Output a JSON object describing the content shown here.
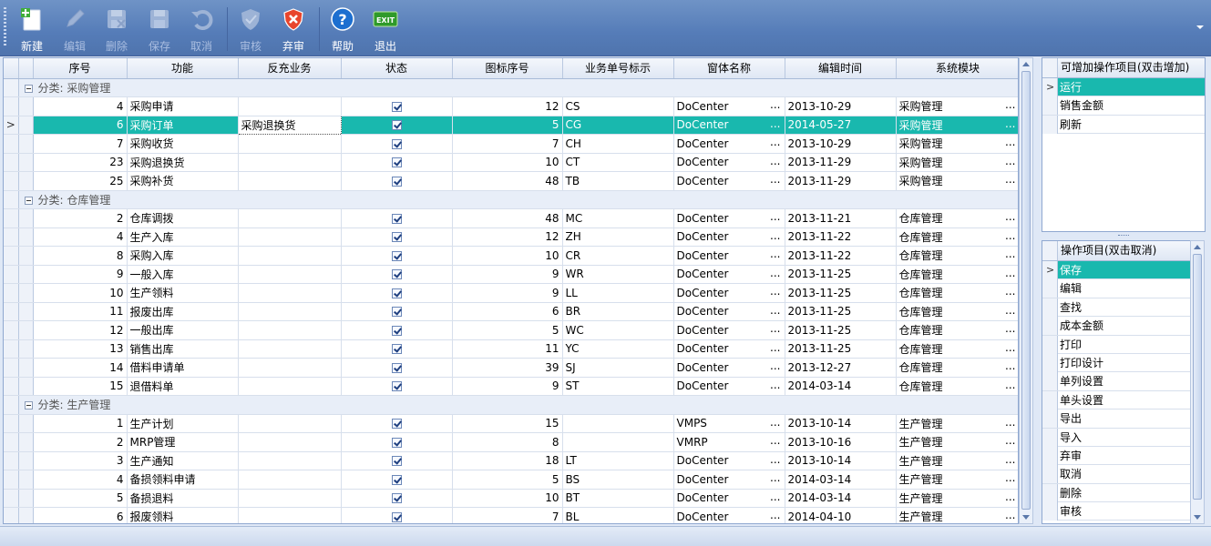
{
  "toolbar": {
    "buttons": [
      {
        "label": "新建",
        "icon": "new-document-icon",
        "enabled": true
      },
      {
        "label": "编辑",
        "icon": "pencil-icon",
        "enabled": false
      },
      {
        "label": "删除",
        "icon": "delete-disk-icon",
        "enabled": false
      },
      {
        "label": "保存",
        "icon": "save-disk-icon",
        "enabled": false
      },
      {
        "label": "取消",
        "icon": "undo-icon",
        "enabled": false
      },
      {
        "label": "审核",
        "icon": "shield-icon",
        "enabled": false
      },
      {
        "label": "弃审",
        "icon": "abandon-x-icon",
        "enabled": true
      },
      {
        "label": "帮助",
        "icon": "help-icon",
        "enabled": true
      },
      {
        "label": "退出",
        "icon": "exit-icon",
        "enabled": true
      }
    ],
    "exit_badge": "EXIT"
  },
  "grid": {
    "columns": [
      "序号",
      "功能",
      "反充业务",
      "状态",
      "图标序号",
      "业务单号标示",
      "窗体名称",
      "编辑时间",
      "系统模块"
    ],
    "groups": [
      {
        "title": "分类: 采购管理",
        "rows": [
          {
            "seq": "4",
            "func": "采购申请",
            "reverse": "",
            "icon_no": "12",
            "code": "CS",
            "form": "DoCenter",
            "time": "2013-10-29",
            "module": "采购管理"
          },
          {
            "seq": "6",
            "func": "采购订单",
            "reverse": "采购退换货",
            "icon_no": "5",
            "code": "CG",
            "form": "DoCenter",
            "time": "2014-05-27",
            "module": "采购管理",
            "selected": true
          },
          {
            "seq": "7",
            "func": "采购收货",
            "reverse": "",
            "icon_no": "7",
            "code": "CH",
            "form": "DoCenter",
            "time": "2013-10-29",
            "module": "采购管理"
          },
          {
            "seq": "23",
            "func": "采购退换货",
            "reverse": "",
            "icon_no": "10",
            "code": "CT",
            "form": "DoCenter",
            "time": "2013-11-29",
            "module": "采购管理"
          },
          {
            "seq": "25",
            "func": "采购补货",
            "reverse": "",
            "icon_no": "48",
            "code": "TB",
            "form": "DoCenter",
            "time": "2013-11-29",
            "module": "采购管理"
          }
        ]
      },
      {
        "title": "分类: 仓库管理",
        "rows": [
          {
            "seq": "2",
            "func": "仓库调拨",
            "reverse": "",
            "icon_no": "48",
            "code": "MC",
            "form": "DoCenter",
            "time": "2013-11-21",
            "module": "仓库管理"
          },
          {
            "seq": "4",
            "func": "生产入库",
            "reverse": "",
            "icon_no": "12",
            "code": "ZH",
            "form": "DoCenter",
            "time": "2013-11-22",
            "module": "仓库管理"
          },
          {
            "seq": "8",
            "func": "采购入库",
            "reverse": "",
            "icon_no": "10",
            "code": "CR",
            "form": "DoCenter",
            "time": "2013-11-22",
            "module": "仓库管理"
          },
          {
            "seq": "9",
            "func": "一般入库",
            "reverse": "",
            "icon_no": "9",
            "code": "WR",
            "form": "DoCenter",
            "time": "2013-11-25",
            "module": "仓库管理"
          },
          {
            "seq": "10",
            "func": "生产领料",
            "reverse": "",
            "icon_no": "9",
            "code": "LL",
            "form": "DoCenter",
            "time": "2013-11-25",
            "module": "仓库管理"
          },
          {
            "seq": "11",
            "func": "报废出库",
            "reverse": "",
            "icon_no": "6",
            "code": "BR",
            "form": "DoCenter",
            "time": "2013-11-25",
            "module": "仓库管理"
          },
          {
            "seq": "12",
            "func": "一般出库",
            "reverse": "",
            "icon_no": "5",
            "code": "WC",
            "form": "DoCenter",
            "time": "2013-11-25",
            "module": "仓库管理"
          },
          {
            "seq": "13",
            "func": "销售出库",
            "reverse": "",
            "icon_no": "11",
            "code": "YC",
            "form": "DoCenter",
            "time": "2013-11-25",
            "module": "仓库管理"
          },
          {
            "seq": "14",
            "func": "借料申请单",
            "reverse": "",
            "icon_no": "39",
            "code": "SJ",
            "form": "DoCenter",
            "time": "2013-12-27",
            "module": "仓库管理"
          },
          {
            "seq": "15",
            "func": "退借料单",
            "reverse": "",
            "icon_no": "9",
            "code": "ST",
            "form": "DoCenter",
            "time": "2014-03-14",
            "module": "仓库管理"
          }
        ]
      },
      {
        "title": "分类: 生产管理",
        "rows": [
          {
            "seq": "1",
            "func": "生产计划",
            "reverse": "",
            "icon_no": "15",
            "code": "",
            "form": "VMPS",
            "time": "2013-10-14",
            "module": "生产管理"
          },
          {
            "seq": "2",
            "func": "MRP管理",
            "reverse": "",
            "icon_no": "8",
            "code": "",
            "form": "VMRP",
            "time": "2013-10-16",
            "module": "生产管理"
          },
          {
            "seq": "3",
            "func": "生产通知",
            "reverse": "",
            "icon_no": "18",
            "code": "LT",
            "form": "DoCenter",
            "time": "2013-10-14",
            "module": "生产管理"
          },
          {
            "seq": "4",
            "func": "备损领料申请",
            "reverse": "",
            "icon_no": "5",
            "code": "BS",
            "form": "DoCenter",
            "time": "2014-03-14",
            "module": "生产管理"
          },
          {
            "seq": "5",
            "func": "备损退料",
            "reverse": "",
            "icon_no": "10",
            "code": "BT",
            "form": "DoCenter",
            "time": "2014-03-14",
            "module": "生产管理"
          },
          {
            "seq": "6",
            "func": "报废领料",
            "reverse": "",
            "icon_no": "7",
            "code": "BL",
            "form": "DoCenter",
            "time": "2014-04-10",
            "module": "生产管理"
          }
        ]
      }
    ],
    "ellipsis": "...",
    "current_row_marker": ">"
  },
  "available_panel": {
    "header": "可增加操作项目(双击增加)",
    "items": [
      "运行",
      "销售金额",
      "刷新"
    ],
    "selected_index": 0
  },
  "operations_panel": {
    "header": "操作项目(双击取消)",
    "items": [
      "保存",
      "编辑",
      "查找",
      "成本金额",
      "打印",
      "打印设计",
      "单列设置",
      "单头设置",
      "导出",
      "导入",
      "弃审",
      "取消",
      "删除",
      "审核"
    ],
    "selected_index": 0
  }
}
